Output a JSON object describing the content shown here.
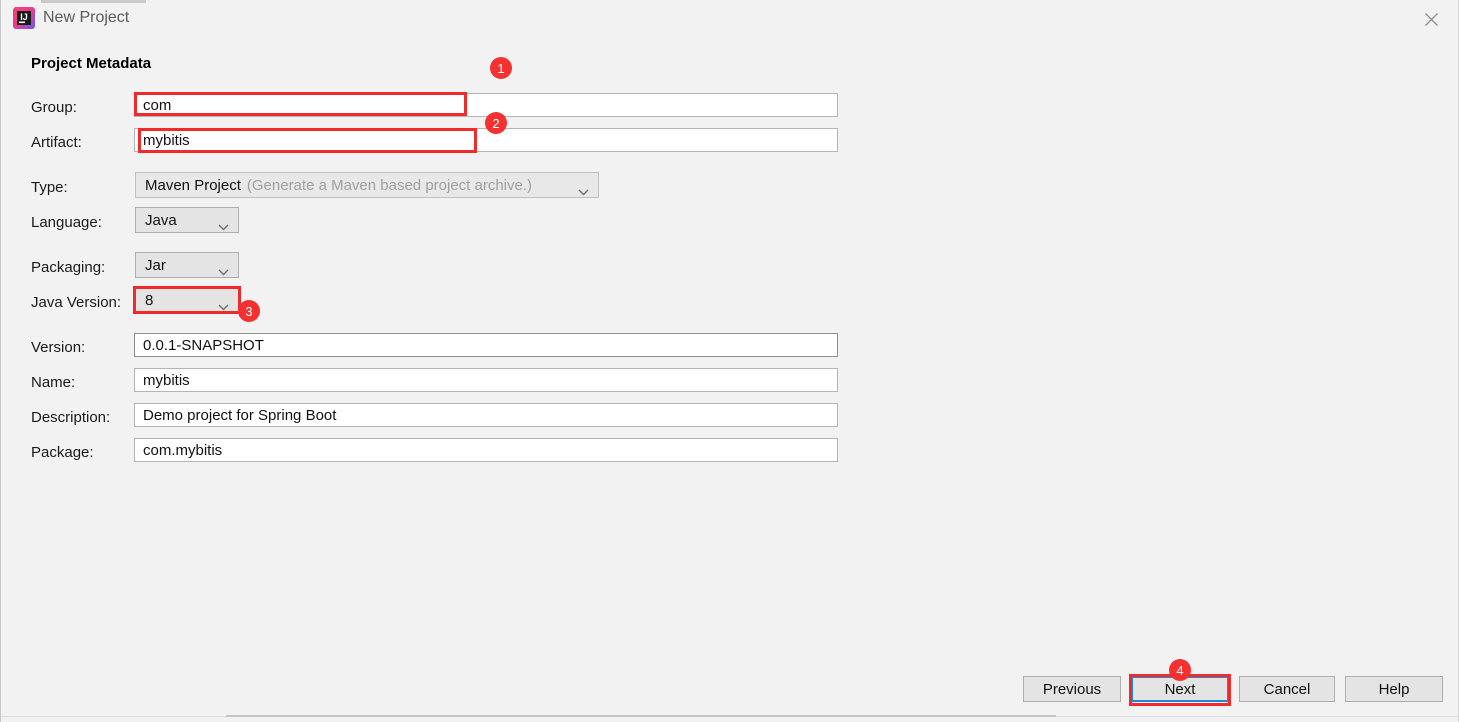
{
  "window": {
    "title": "New Project",
    "app_icon": "intellij-idea-icon",
    "close_icon": "close-icon",
    "background_color": "#f2f2f2"
  },
  "form": {
    "section_title": "Project Metadata",
    "fields": [
      {
        "label": "Group:",
        "value": "com",
        "kind": "text"
      },
      {
        "label": "Artifact:",
        "value": "mybitis",
        "kind": "text"
      },
      {
        "label": "Type:",
        "value": "Maven Project",
        "hint": "(Generate a Maven based project archive.)",
        "kind": "combo"
      },
      {
        "label": "Language:",
        "value": "Java",
        "kind": "combo"
      },
      {
        "label": "Packaging:",
        "value": "Jar",
        "kind": "combo"
      },
      {
        "label": "Java Version:",
        "value": "8",
        "kind": "combo"
      },
      {
        "label": "Version:",
        "value": "0.0.1-SNAPSHOT",
        "kind": "text"
      },
      {
        "label": "Name:",
        "value": "mybitis",
        "kind": "text"
      },
      {
        "label": "Description:",
        "value": "Demo project for Spring Boot",
        "kind": "text"
      },
      {
        "label": "Package:",
        "value": "com.mybitis",
        "kind": "text"
      }
    ]
  },
  "buttons": {
    "previous": "Previous",
    "next": "Next",
    "cancel": "Cancel",
    "help": "Help",
    "focused": "Next",
    "focus_color": "#1e88d8"
  },
  "annotations": {
    "color": "#f43030",
    "badges": [
      {
        "number": "1",
        "target": "group-field"
      },
      {
        "number": "2",
        "target": "artifact-field"
      },
      {
        "number": "3",
        "target": "java-version-combo"
      },
      {
        "number": "4",
        "target": "next-button"
      }
    ]
  }
}
